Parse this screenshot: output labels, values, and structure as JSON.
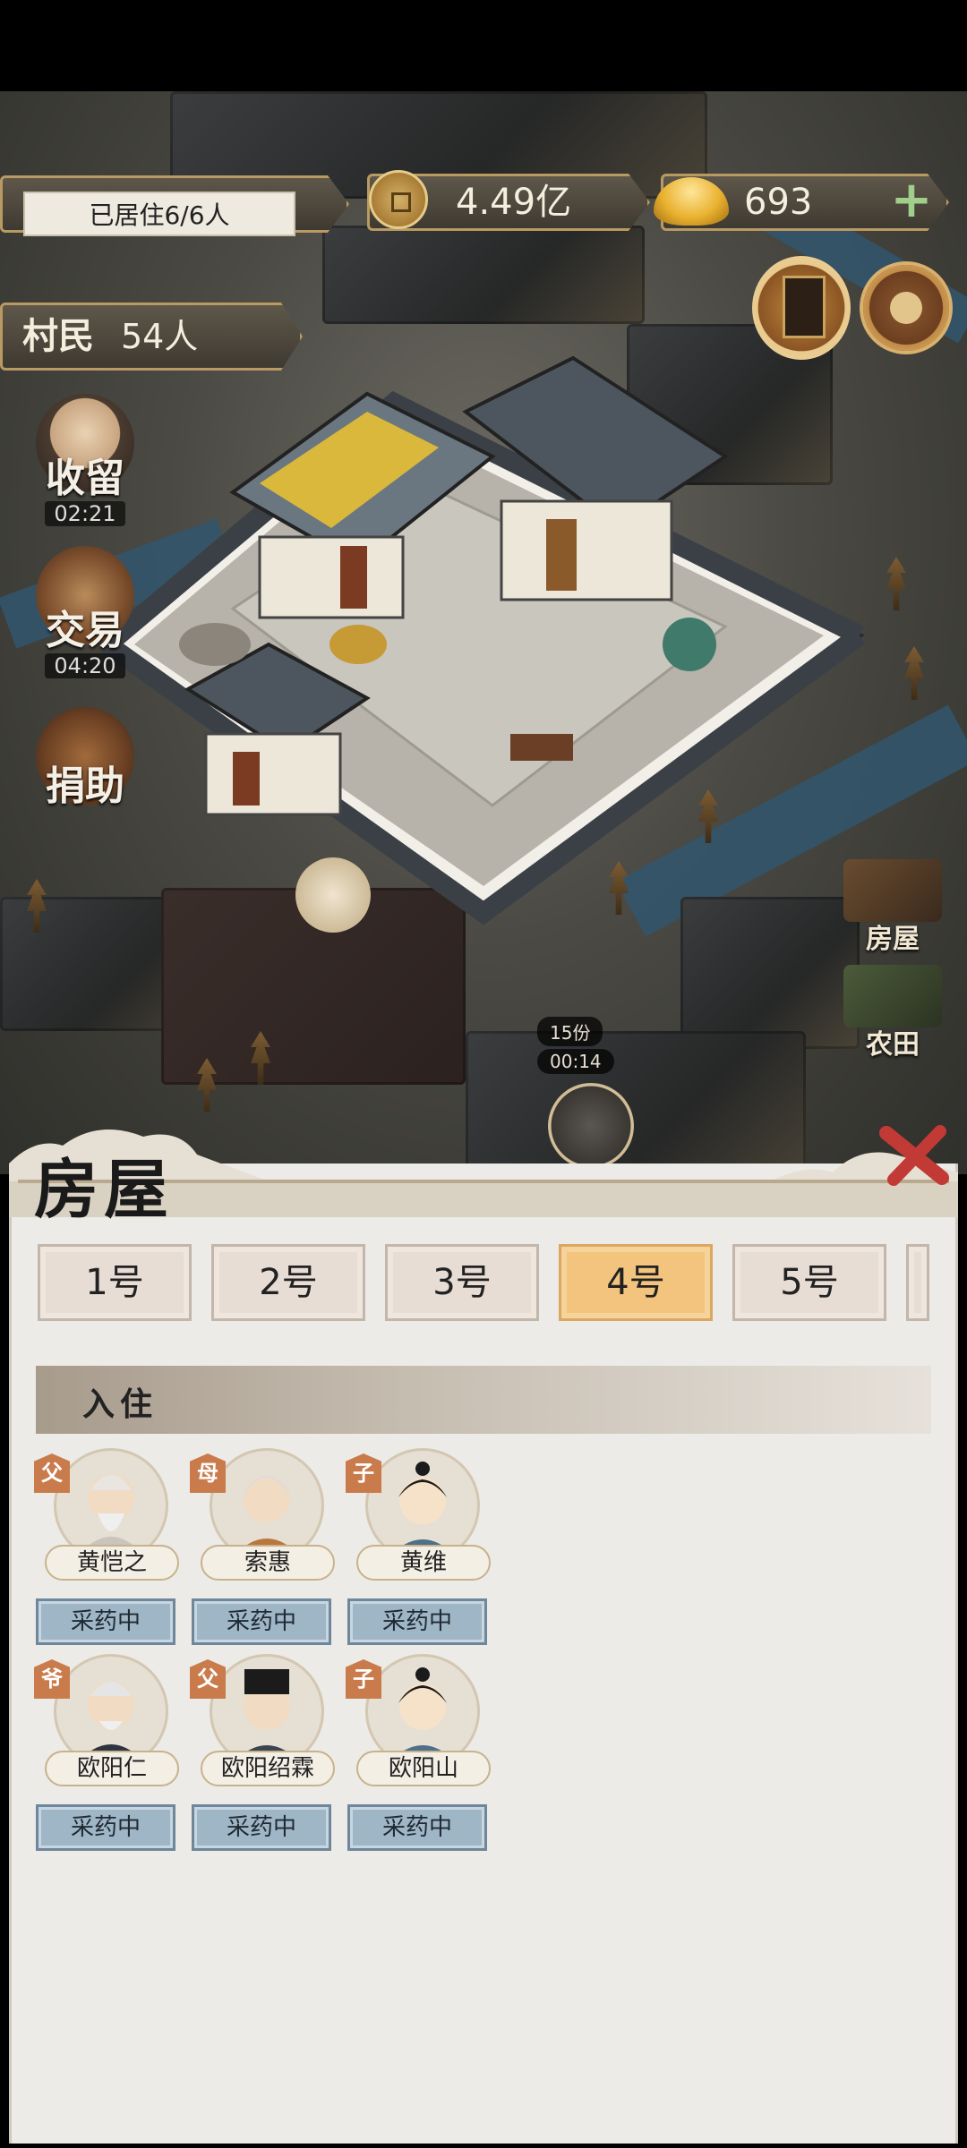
{
  "hud": {
    "residents": "已居住6/6人",
    "coins": "4.49亿",
    "ingots": "693",
    "villagers_label": "村民",
    "villagers_count": "54人"
  },
  "side_buttons": [
    {
      "label": "收留",
      "timer": "02:21"
    },
    {
      "label": "交易",
      "timer": "04:20"
    },
    {
      "label": "捐助",
      "timer": ""
    }
  ],
  "scene_tags": {
    "portions": "15份",
    "timer": "00:14"
  },
  "right_list": [
    {
      "label": "房屋"
    },
    {
      "label": "农田"
    }
  ],
  "panel": {
    "title": "房屋",
    "tabs": [
      "1号",
      "2号",
      "3号",
      "4号",
      "5号"
    ],
    "active_tab": "4号",
    "section_title": "入住",
    "members": [
      {
        "role": "父",
        "name": "黄恺之",
        "status": "采药中"
      },
      {
        "role": "母",
        "name": "索惠",
        "status": "采药中"
      },
      {
        "role": "子",
        "name": "黄维",
        "status": "采药中"
      },
      {
        "role": "爷",
        "name": "欧阳仁",
        "status": "采药中"
      },
      {
        "role": "父",
        "name": "欧阳绍霖",
        "status": "采药中"
      },
      {
        "role": "子",
        "name": "欧阳山",
        "status": "采药中"
      }
    ]
  },
  "colors": {
    "active_tab": "#f3c47e",
    "status_button": "#9fb6c7",
    "role_badge": "#c97b4c",
    "panel_bg": "#ecebe7"
  }
}
